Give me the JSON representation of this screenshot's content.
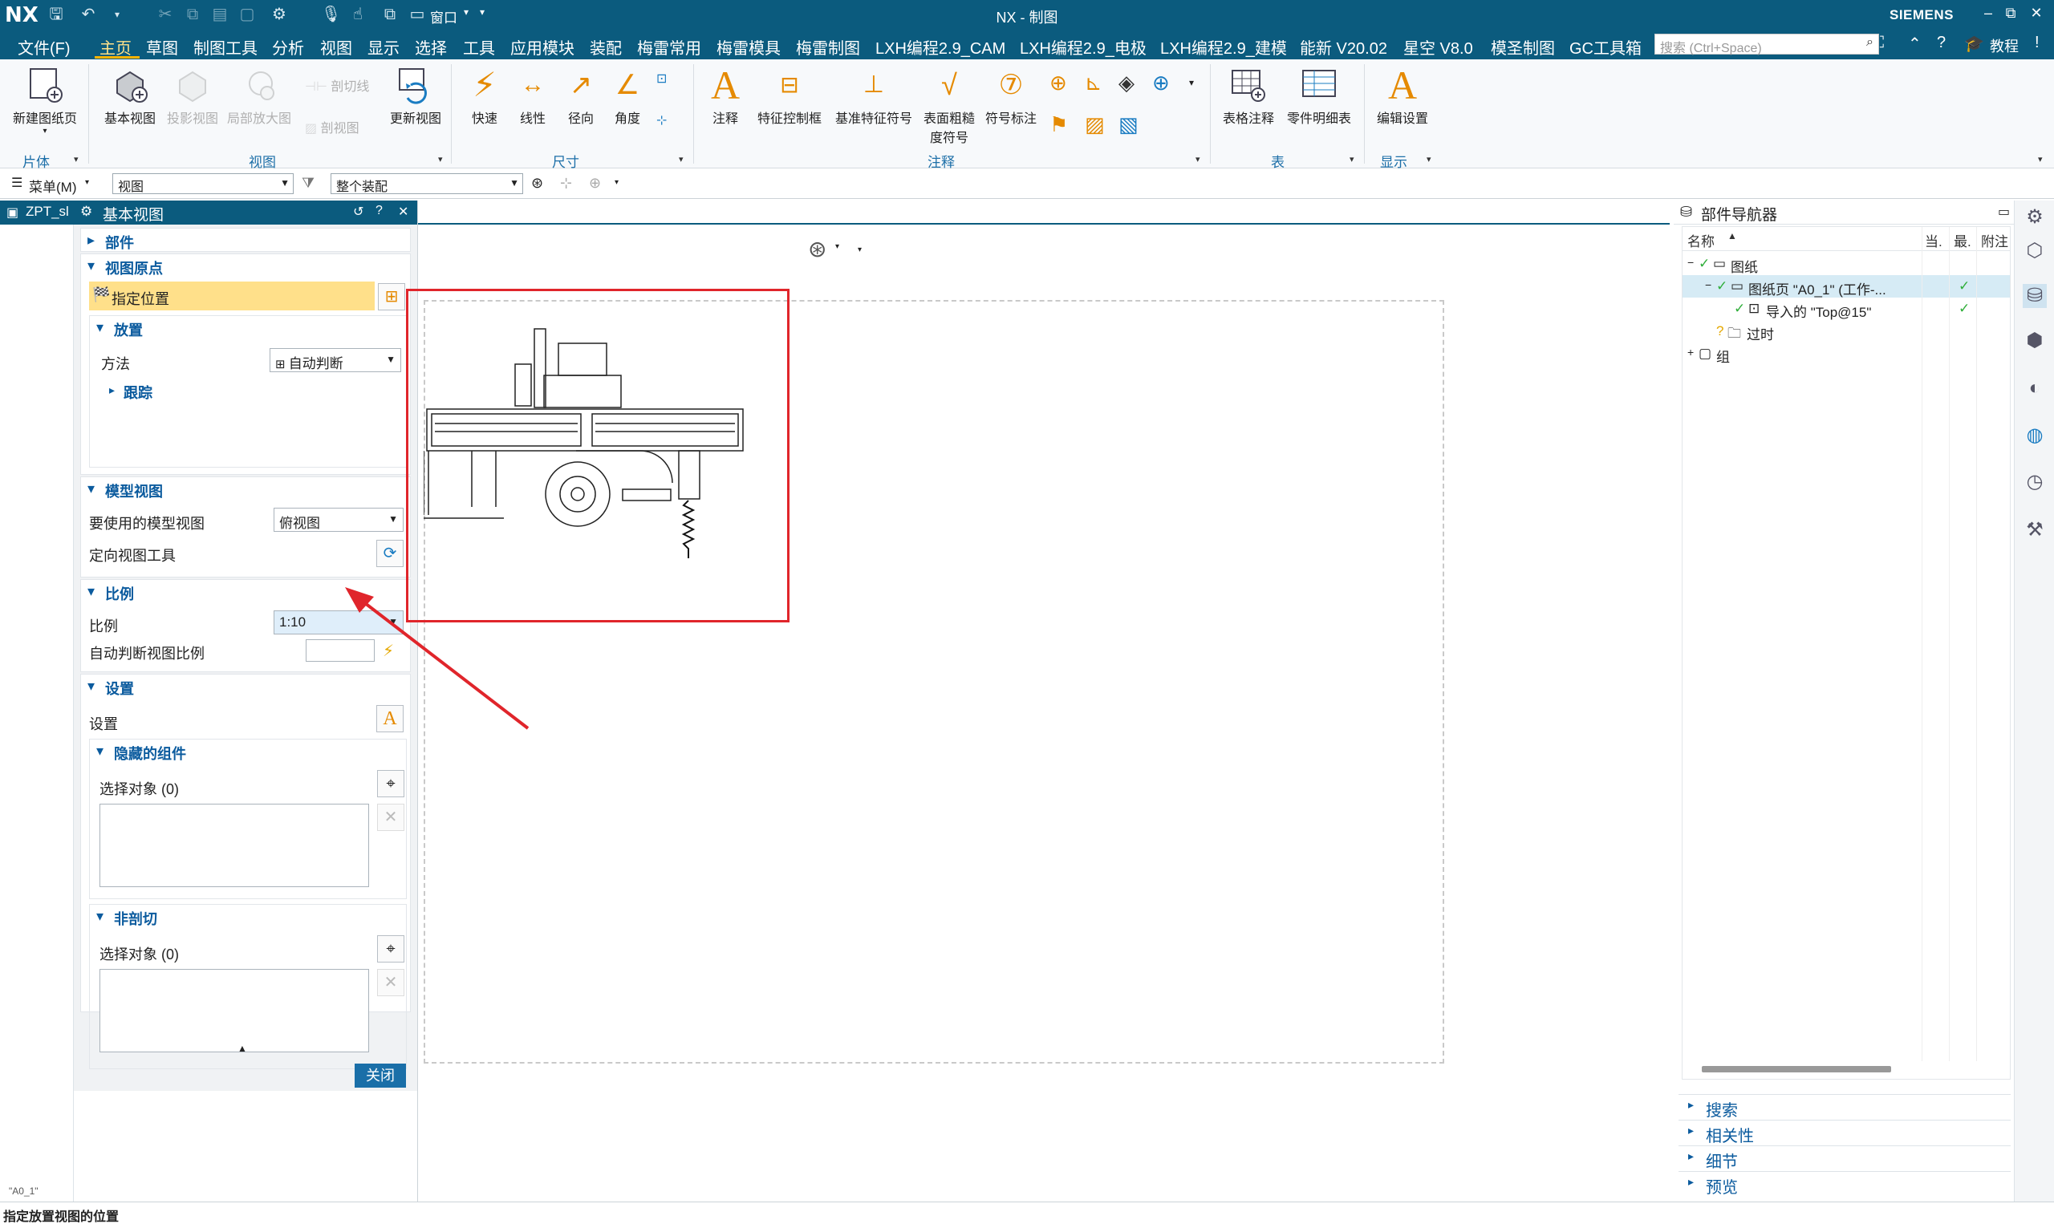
{
  "titlebar": {
    "app_logo": "NX",
    "window_title": "NX - 制图",
    "window_menu_label": "窗口",
    "brand": "SIEMENS"
  },
  "menubar": {
    "file": "文件(F)",
    "items": [
      "主页",
      "草图",
      "制图工具",
      "分析",
      "视图",
      "显示",
      "选择",
      "工具",
      "应用模块",
      "装配",
      "梅雷常用",
      "梅雷模具",
      "梅雷制图",
      "LXH编程2.9_CAM",
      "LXH编程2.9_电极",
      "LXH编程2.9_建模",
      "能新 V20.02",
      "星空 V8.0",
      "模圣制图",
      "GC工具箱"
    ],
    "active_item": "主页",
    "search_placeholder": "搜索 (Ctrl+Space)",
    "tutorial": "教程"
  },
  "ribbon": {
    "new_sheet": "新建图纸页",
    "base_view": "基本视图",
    "projected_view": "投影视图",
    "detail_view": "局部放大图",
    "section_line": "剖切线",
    "section_view": "剖视图",
    "update_view": "更新视图",
    "rapid": "快速",
    "linear": "线性",
    "radial": "径向",
    "angular": "角度",
    "note": "注释",
    "fcf": "特征控制框",
    "datum_symbol": "基准特征符号",
    "surface_finish_line1": "表面粗糙",
    "surface_finish_line2": "度符号",
    "balloon": "符号标注",
    "tabular_note": "表格注释",
    "parts_list": "零件明细表",
    "edit_settings": "编辑设置",
    "groups": {
      "sheet": "片体",
      "view": "视图",
      "dimension": "尺寸",
      "annotation": "注释",
      "table": "表",
      "display": "显示"
    }
  },
  "toolbar2": {
    "menu_label": "菜单(M)",
    "filter_value": "视图",
    "assembly_value": "整个装配"
  },
  "tabstrip": {
    "file_tab": "ZPT_sl",
    "dialog_title": "基本视图"
  },
  "dialog": {
    "part_section": "部件",
    "view_origin_section": "视图原点",
    "specify_location": "指定位置",
    "placement_section": "放置",
    "method_label": "方法",
    "method_value": "自动判断",
    "tracking": "跟踪",
    "model_view_section": "模型视图",
    "model_view_label": "要使用的模型视图",
    "model_view_value": "俯视图",
    "orient_tool_label": "定向视图工具",
    "scale_section": "比例",
    "scale_label": "比例",
    "scale_value": "1:10",
    "auto_scale_label": "自动判断视图比例",
    "settings_section": "设置",
    "settings_label": "设置",
    "hidden_components_section": "隐藏的组件",
    "select_objects_1": "选择对象 (0)",
    "non_section_section": "非剖切",
    "select_objects_2": "选择对象 (0)",
    "close_button": "关闭"
  },
  "navigator": {
    "title": "部件导航器",
    "columns": [
      "名称",
      "当.",
      "最.",
      "附注"
    ],
    "rows": [
      {
        "label": "图纸",
        "status": ""
      },
      {
        "label": "图纸页 \"A0_1\" (工作-...",
        "status": "✓"
      },
      {
        "label": "导入的 \"Top@15\"",
        "status": "✓"
      },
      {
        "label": "过时",
        "status": ""
      },
      {
        "label": "组",
        "status": ""
      }
    ],
    "panels": [
      "搜索",
      "相关性",
      "细节",
      "预览"
    ]
  },
  "canvas": {
    "sheet_name": "\"A0_1\""
  },
  "statusbar": {
    "message": "指定放置视图的位置"
  },
  "colors": {
    "titlebar": "#0b5b7e",
    "highlight_row": "#ffe08a",
    "annotation_red": "#e0252b",
    "check_green": "#2fae3a"
  }
}
